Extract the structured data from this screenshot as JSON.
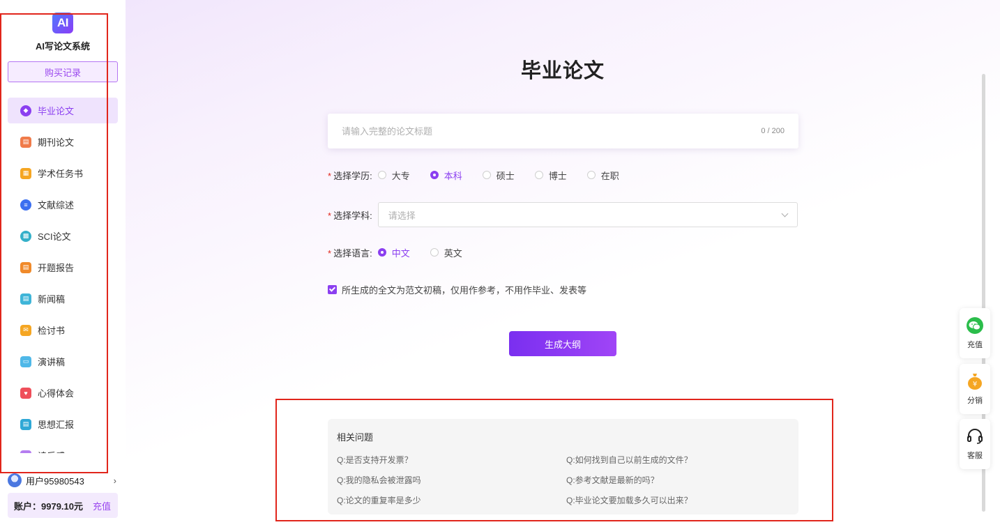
{
  "sidebar": {
    "logo_text": "AI",
    "app_name": "AI写论文系统",
    "buy_records": "购买记录",
    "items": [
      {
        "label": "毕业论文",
        "icon": "graduation-cap-icon",
        "color": "#8b3ff0",
        "glyph": "◆",
        "active": true
      },
      {
        "label": "期刊论文",
        "icon": "journal-icon",
        "color": "#f07b4a",
        "glyph": "▤",
        "active": false
      },
      {
        "label": "学术任务书",
        "icon": "task-book-icon",
        "color": "#f5a623",
        "glyph": "▦",
        "active": false
      },
      {
        "label": "文献综述",
        "icon": "list-icon",
        "color": "#3b6ff0",
        "glyph": "≡",
        "active": false
      },
      {
        "label": "SCI论文",
        "icon": "sci-icon",
        "color": "#35b0c9",
        "glyph": "▩",
        "active": false
      },
      {
        "label": "开题报告",
        "icon": "report-icon",
        "color": "#f08a2a",
        "glyph": "▤",
        "active": false
      },
      {
        "label": "新闻稿",
        "icon": "news-icon",
        "color": "#3fb5d8",
        "glyph": "▤",
        "active": false
      },
      {
        "label": "检讨书",
        "icon": "envelope-icon",
        "color": "#f5a623",
        "glyph": "✉",
        "active": false
      },
      {
        "label": "演讲稿",
        "icon": "speech-icon",
        "color": "#4fb8e8",
        "glyph": "▭",
        "active": false
      },
      {
        "label": "心得体会",
        "icon": "heart-note-icon",
        "color": "#ef4f5a",
        "glyph": "♥",
        "active": false
      },
      {
        "label": "思想汇报",
        "icon": "thought-report-icon",
        "color": "#2fa8d6",
        "glyph": "▤",
        "active": false
      },
      {
        "label": "读后感",
        "icon": "book-icon",
        "color": "#b57df0",
        "glyph": "▤",
        "active": false
      }
    ],
    "user_name": "用户95980543",
    "account_text": "账户：9979.10元",
    "recharge_link": "充值"
  },
  "main": {
    "page_title": "毕业论文",
    "title_input": {
      "placeholder": "请输入完整的论文标题",
      "value": "",
      "count": "0 / 200"
    },
    "education": {
      "required_mark": "*",
      "label": "选择学历:",
      "options": [
        "大专",
        "本科",
        "硕士",
        "博士",
        "在职"
      ],
      "selected": "本科"
    },
    "subject": {
      "required_mark": "*",
      "label": "选择学科:",
      "placeholder": "请选择"
    },
    "language": {
      "required_mark": "*",
      "label": "选择语言:",
      "options": [
        "中文",
        "英文"
      ],
      "selected": "中文"
    },
    "disclaimer": "所生成的全文为范文初稿，仅用作参考，不用作毕业、发表等",
    "disclaimer_checked": true,
    "generate_button": "生成大纲",
    "faq": {
      "title": "相关问题",
      "questions": [
        "Q:是否支持开发票？",
        "Q:如何找到自己以前生成的文件？",
        "Q:我的隐私会被泄露吗",
        "Q:参考文献是最新的吗？",
        "Q:论文的重复率是多少",
        "Q:毕业论文要加载多久可以出来？"
      ]
    }
  },
  "floating": {
    "recharge": {
      "label": "充值",
      "icon": "wechat-icon",
      "color": "#2bbd4b"
    },
    "distribute": {
      "label": "分销",
      "icon": "money-bag-icon",
      "color": "#f5a623"
    },
    "service": {
      "label": "客服",
      "icon": "headset-icon",
      "color": "#222222"
    }
  },
  "colors": {
    "accent": "#8b3ff0",
    "annotation_red": "#e1251b"
  }
}
